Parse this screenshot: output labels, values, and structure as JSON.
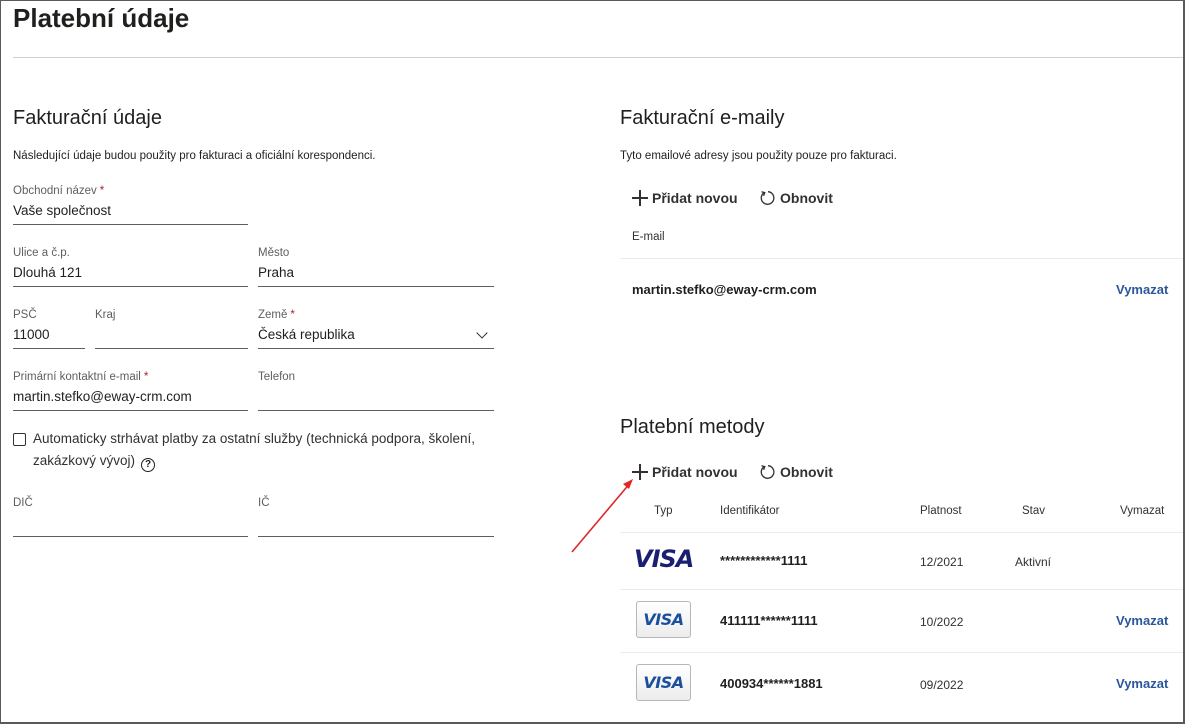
{
  "page": {
    "title": "Platební údaje"
  },
  "billing": {
    "title": "Fakturační údaje",
    "description": "Následující údaje budou použity pro fakturaci a oficiální korespondenci.",
    "fields": {
      "company": {
        "label": "Obchodní název",
        "value": "Vaše společnost",
        "required": "*"
      },
      "street": {
        "label": "Ulice a č.p.",
        "value": "Dlouhá 121"
      },
      "city": {
        "label": "Město",
        "value": "Praha"
      },
      "zip": {
        "label": "PSČ",
        "value": "11000"
      },
      "region": {
        "label": "Kraj",
        "value": ""
      },
      "country": {
        "label": "Země",
        "value": "Česká republika",
        "required": "*"
      },
      "email": {
        "label": "Primární kontaktní e-mail",
        "value": "martin.stefko@eway-crm.com",
        "required": "*"
      },
      "phone": {
        "label": "Telefon",
        "value": ""
      },
      "dic": {
        "label": "DIČ",
        "value": ""
      },
      "ic": {
        "label": "IČ",
        "value": ""
      }
    },
    "auto_charge": {
      "label": "Automaticky strhávat platby za ostatní služby (technická podpora, školení, zakázkový vývoj)",
      "checked": false,
      "help_icon": "?"
    }
  },
  "emails": {
    "title": "Fakturační e-maily",
    "description": "Tyto emailové adresy jsou použity pouze pro fakturaci.",
    "add_label": "Přidat novou",
    "refresh_label": "Obnovit",
    "column_email": "E-mail",
    "rows": [
      {
        "email": "martin.stefko@eway-crm.com",
        "delete_label": "Vymazat"
      }
    ]
  },
  "payment_methods": {
    "title": "Platební metody",
    "add_label": "Přidat novou",
    "refresh_label": "Obnovit",
    "columns": {
      "type": "Typ",
      "identifier": "Identifikátor",
      "validity": "Platnost",
      "status": "Stav",
      "delete": "Vymazat"
    },
    "rows": [
      {
        "type": "VISA",
        "identifier": "************1111",
        "validity": "12/2021",
        "status": "Aktivní",
        "delete_label": ""
      },
      {
        "type": "VISA",
        "identifier": "411111******1111",
        "validity": "10/2022",
        "status": "",
        "delete_label": "Vymazat"
      },
      {
        "type": "VISA",
        "identifier": "400934******1881",
        "validity": "09/2022",
        "status": "",
        "delete_label": "Vymazat"
      }
    ]
  },
  "colors": {
    "link": "#2b579a",
    "required": "#a4262c",
    "annotation_arrow": "#e0262b",
    "visa_blue": "#1a1f71"
  }
}
